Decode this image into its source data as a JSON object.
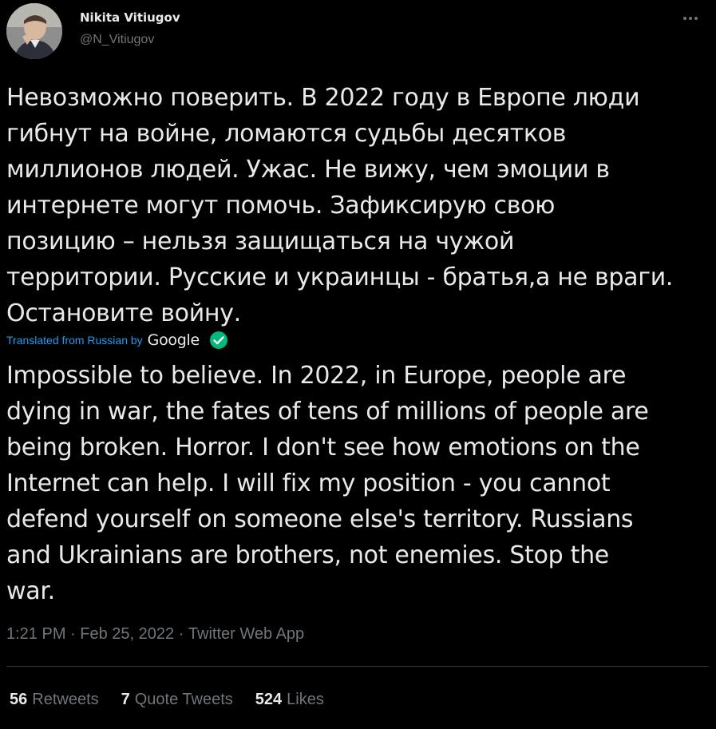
{
  "user": {
    "display_name": "Nikita Vitiugov",
    "handle": "@N_Vitiugov"
  },
  "tweet": {
    "original_text": "Невозможно поверить. В 2022 году в Европе люди\nгибнут на войне, ломаются судьбы десятков\nмиллионов людей. Ужас. Не вижу, чем эмоции в\nинтернете могут помочь. Зафиксирую свою\nпозицию – нельзя защищаться на чужой\nтерритории. Русские и украинцы - братья,а не враги.\nОстановите войну.",
    "translation_label": "Translated from Russian by",
    "translation_provider": "Google",
    "translated_text": "Impossible to believe. In 2022, in Europe, people are\ndying in war, the fates of tens of millions of people are\nbeing broken. Horror. I don't see how emotions on the\nInternet can help. I will fix my position - you cannot\ndefend yourself on someone else's territory. Russians\nand Ukrainians are brothers, not enemies. Stop the\nwar.",
    "time": "1:21 PM",
    "separator": " · ",
    "date": "Feb 25, 2022",
    "source": "Twitter Web App"
  },
  "stats": {
    "retweets_count": "56",
    "retweets_label": "Retweets",
    "quotes_count": "7",
    "quotes_label": "Quote Tweets",
    "likes_count": "524",
    "likes_label": "Likes"
  },
  "icons": {
    "more": "more-options-icon",
    "verified_check": "check-circle-icon"
  },
  "colors": {
    "background": "#000000",
    "text": "#e7e9ea",
    "secondary": "#71767b",
    "link": "#1d9bf0",
    "check": "#00ba7c",
    "divider": "#2f3336"
  }
}
